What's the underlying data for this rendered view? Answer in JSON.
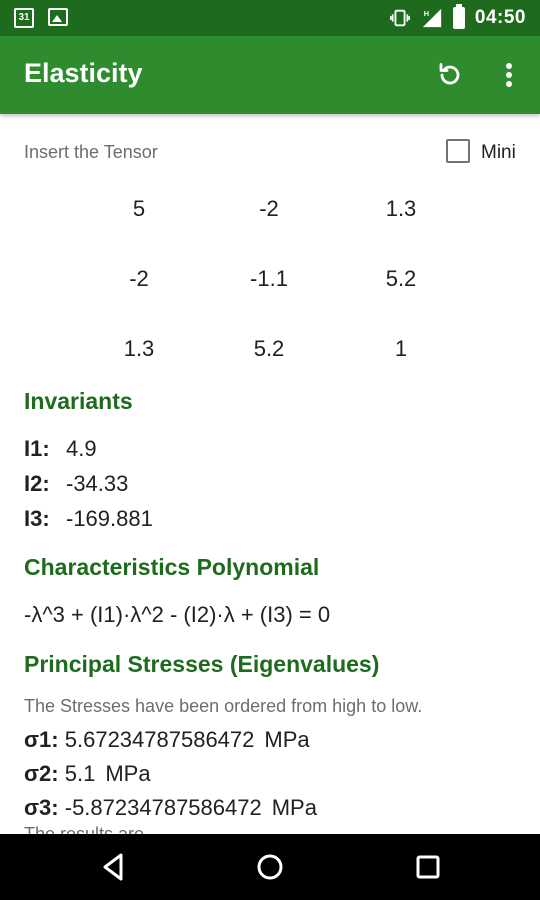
{
  "status_bar": {
    "time": "04:50",
    "calendar_day": "31",
    "icons": [
      "calendar-icon",
      "image-icon",
      "vibrate-icon",
      "signal-icon",
      "battery-icon"
    ]
  },
  "app_bar": {
    "title": "Elasticity",
    "background": "#2e8b2e",
    "icons": [
      "refresh-icon",
      "more-vert-icon"
    ]
  },
  "tensor_input": {
    "label": "Insert the Tensor",
    "mini_label": "Mini",
    "mini_checked": false,
    "rows": [
      [
        "5",
        "-2",
        "1.3"
      ],
      [
        "-2",
        "-1.1",
        "5.2"
      ],
      [
        "1.3",
        "5.2",
        "1"
      ]
    ]
  },
  "invariants": {
    "heading": "Invariants",
    "items": [
      {
        "key": "I1:",
        "value": "4.9"
      },
      {
        "key": "I2:",
        "value": "-34.33"
      },
      {
        "key": "I3:",
        "value": "-169.881"
      }
    ]
  },
  "polynomial": {
    "heading": "Characteristics Polynomial",
    "expression": "-λ^3 + (I1)·λ^2 - (I2)·λ + (I3) = 0"
  },
  "principal_stresses": {
    "heading": "Principal Stresses (Eigenvalues)",
    "note": "The Stresses have been ordered from high to low.",
    "items": [
      {
        "key": "σ1:",
        "value": "5.67234787586472",
        "unit": "MPa"
      },
      {
        "key": "σ2:",
        "value": "5.1",
        "unit": "MPa"
      },
      {
        "key": "σ3:",
        "value": "-5.87234787586472",
        "unit": "MPa"
      }
    ],
    "cut_off_text": "The results are ...",
    "heading_color": "#1e6b1e"
  },
  "nav_bar": {
    "icons": [
      "back-icon",
      "home-icon",
      "recents-icon"
    ]
  }
}
